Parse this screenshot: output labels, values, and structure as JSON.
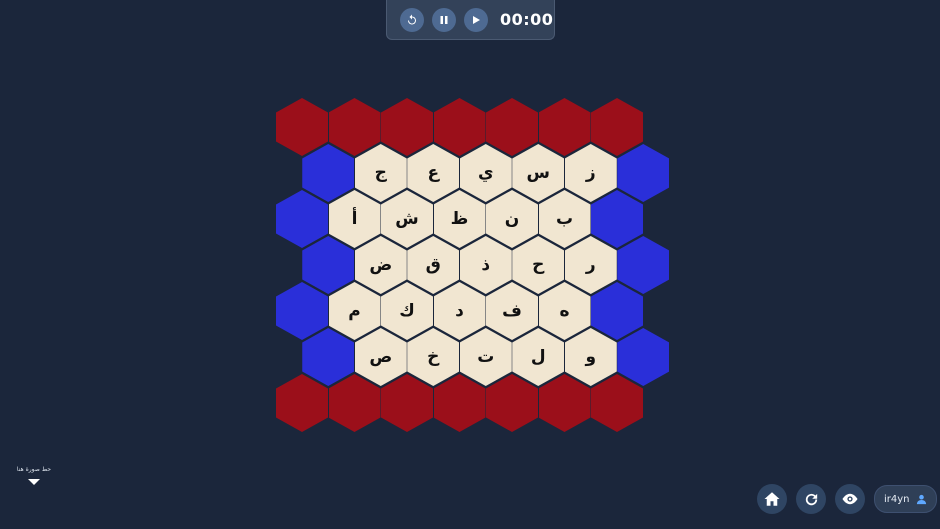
{
  "timer": {
    "display": "00:00",
    "buttons": [
      {
        "icon": "restart-icon"
      },
      {
        "icon": "pause-icon"
      },
      {
        "icon": "play-icon"
      }
    ]
  },
  "board": {
    "colors": {
      "red": "#9b0f1a",
      "blue": "#2a2fd9",
      "cell": "#f1e6d1"
    },
    "rows": [
      [
        "ج",
        "ع",
        "ي",
        "س",
        "ز"
      ],
      [
        "أ",
        "ش",
        "ظ",
        "ن",
        "ب"
      ],
      [
        "ض",
        "ق",
        "ذ",
        "ح",
        "ر"
      ],
      [
        "م",
        "ك",
        "د",
        "ف",
        "ه"
      ],
      [
        "ص",
        "خ",
        "ت",
        "ل",
        "و"
      ]
    ]
  },
  "side_panel": {
    "note": "حط صورة هنا"
  },
  "controls": {
    "home": {
      "icon": "home-icon"
    },
    "refresh": {
      "icon": "refresh-icon"
    },
    "view": {
      "icon": "eye-icon"
    },
    "user": {
      "name": "ir4yn",
      "icon": "user-icon"
    }
  }
}
